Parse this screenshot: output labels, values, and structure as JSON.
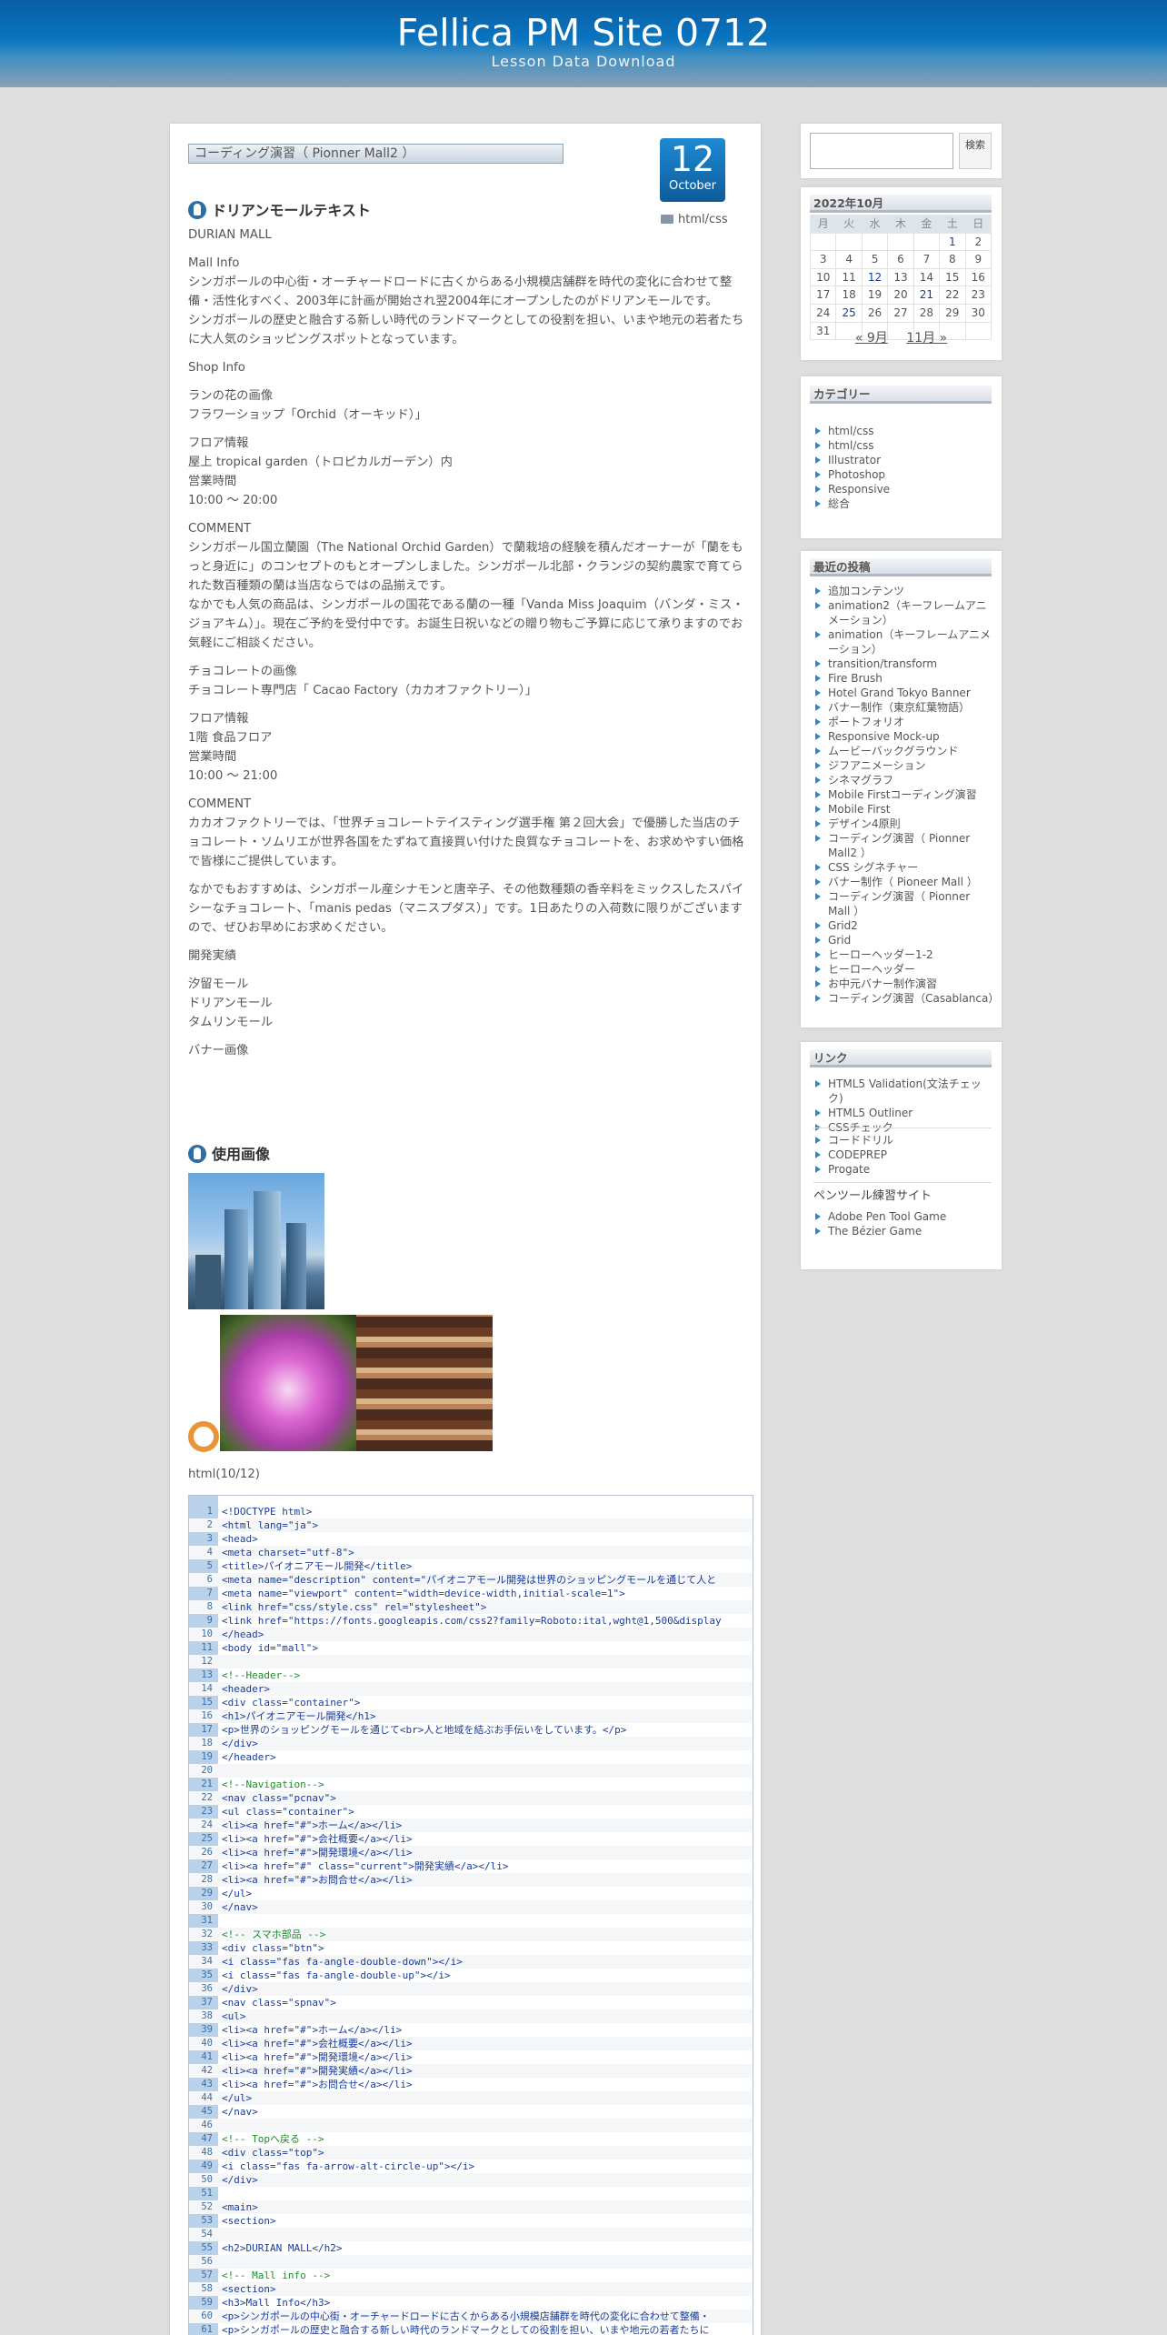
{
  "header": {
    "title": "Fellica PM Site 0712",
    "description": "Lesson Data Download"
  },
  "post": {
    "title": "コーディング演習（ Pionner Mall2 ）",
    "date_day": "12",
    "date_month": "October",
    "category": "html/css",
    "section_text_heading": "ドリアンモールテキスト",
    "paragraphs": [
      "DURIAN MALL",
      "Mall Info\nシンガポールの中心街・オーチャードロードに古くからある小規模店舗群を時代の変化に合わせて整備・活性化すべく、2003年に計画が開始され翌2004年にオープンしたのがドリアンモールです。\nシンガポールの歴史と融合する新しい時代のランドマークとしての役割を担い、いまや地元の若者たちに大人気のショッピングスポットとなっています。",
      "Shop Info",
      "ランの花の画像\nフラワーショップ「Orchid（オーキッド）」",
      "フロア情報\n屋上 tropical garden（トロピカルガーデン）内\n営業時間\n10:00 ～ 20:00",
      "COMMENT\nシンガポール国立蘭園（The National Orchid Garden）で蘭栽培の経験を積んだオーナーが「蘭をもっと身近に」のコンセプトのもとオープンしました。シンガポール北部・クランジの契約農家で育てられた数百種類の蘭は当店ならではの品揃えです。\nなかでも人気の商品は、シンガポールの国花である蘭の一種「Vanda Miss Joaquim（バンダ・ミス・ジョアキム）」。現在ご予約を受付中です。お誕生日祝いなどの贈り物もご予算に応じて承りますのでお気軽にご相談ください。",
      "チョコレートの画像\nチョコレート専門店「 Cacao Factory（カカオファクトリー）」",
      "フロア情報\n1階 食品フロア\n営業時間\n10:00 ～ 21:00",
      "COMMENT\nカカオファクトリーでは、「世界チョコレートテイスティング選手権 第２回大会」で優勝した当店のチョコレート・ソムリエが世界各国をたずねて直接買い付けた良質なチョコレートを、お求めやすい価格で皆様にご提供しています。",
      "なかでもおすすめは、シンガポール産シナモンと唐辛子、その他数種類の香辛料をミックスしたスパイシーなチョコレート、「manis pedas（マニスプダス）」です。1日あたりの入荷数に限りがございますので、ぜひお早めにお求めください。",
      "開発実績",
      "汐留モール\nドリアンモール\nタムリンモール",
      "バナー画像"
    ],
    "section_images_heading": "使用画像",
    "code_label": "html(10/12)",
    "code_lines": [
      "<!DOCTYPE html>",
      "<html lang=\"ja\">",
      "<head>",
      "<meta charset=\"utf-8\">",
      "<title>パイオニアモール開発</title>",
      "<meta name=\"description\" content=\"パイオニアモール開発は世界のショッピングモールを通じて人と",
      "<meta name=\"viewport\" content=\"width=device-width,initial-scale=1\">",
      "<link href=\"css/style.css\" rel=\"stylesheet\">",
      "<link href=\"https://fonts.googleapis.com/css2?family=Roboto:ital,wght@1,500&display",
      "</head>",
      "<body id=\"mall\">",
      "",
      "<!--Header-->",
      "<header>",
      "<div class=\"container\">",
      "<h1>パイオニアモール開発</h1>",
      "<p>世界のショッピングモールを通じて<br>人と地域を結ぶお手伝いをしています。</p>",
      "</div>",
      "</header>",
      "",
      "<!--Navigation-->",
      "<nav class=\"pcnav\">",
      "<ul class=\"container\">",
      "<li><a href=\"#\">ホーム</a></li>",
      "<li><a href=\"#\">会社概要</a></li>",
      "<li><a href=\"#\">開発環境</a></li>",
      "<li><a href=\"#\" class=\"current\">開発実績</a></li>",
      "<li><a href=\"#\">お問合せ</a></li>",
      "</ul>",
      "</nav>",
      "",
      "<!-- スマホ部品 -->",
      "<div class=\"btn\">",
      "<i class=\"fas fa-angle-double-down\"></i>",
      "<i class=\"fas fa-angle-double-up\"></i>",
      "</div>",
      "<nav class=\"spnav\">",
      "<ul>",
      "<li><a href=\"#\">ホーム</a></li>",
      "<li><a href=\"#\">会社概要</a></li>",
      "<li><a href=\"#\">開発環境</a></li>",
      "<li><a href=\"#\">開発実績</a></li>",
      "<li><a href=\"#\">お問合せ</a></li>",
      "</ul>",
      "</nav>",
      "",
      "<!-- Topへ戻る -->",
      "<div class=\"top\">",
      "<i class=\"fas fa-arrow-alt-circle-up\"></i>",
      "</div>",
      "",
      "<main>",
      "<section>",
      "",
      "<h2>DURIAN MALL</h2>",
      "",
      "<!-- Mall info -->",
      "<section>",
      "<h3>Mall Info</h3>",
      "<p>シンガポールの中心街・オーチャードロードに古くからある小規模店舗群を時代の変化に合わせて整備・",
      "<p>シンガポールの歴史と融合する新しい時代のランドマークとしての役割を担い、いまや地元の若者たちに"
    ]
  },
  "sidebar": {
    "search_button": "検索",
    "calendar": {
      "title": "2022年10月",
      "weekdays": [
        "月",
        "火",
        "水",
        "木",
        "金",
        "土",
        "日"
      ],
      "rows": [
        [
          "",
          "",
          "",
          "",
          "",
          "1",
          "2"
        ],
        [
          "3",
          "4",
          "5",
          "6",
          "7",
          "8",
          "9"
        ],
        [
          "10",
          "11",
          "12",
          "13",
          "14",
          "15",
          "16"
        ],
        [
          "17",
          "18",
          "19",
          "20",
          "21",
          "22",
          "23"
        ],
        [
          "24",
          "25",
          "26",
          "27",
          "28",
          "29",
          "30"
        ],
        [
          "31",
          "",
          "",
          "",
          "",
          "",
          ""
        ]
      ],
      "linked_days": [
        "1",
        "12",
        "21",
        "25"
      ],
      "prev": "« 9月",
      "next": "11月 »"
    },
    "categories": {
      "title": "カテゴリー",
      "items": [
        "html/css",
        "html/css",
        "Illustrator",
        "Photoshop",
        "Responsive",
        "総合"
      ]
    },
    "recent": {
      "title": "最近の投稿",
      "items": [
        "追加コンテンツ",
        "animation2（キーフレームアニメーション）",
        "animation（キーフレームアニメーション）",
        "transition/transform",
        "Fire Brush",
        "Hotel Grand Tokyo Banner",
        "バナー制作（東京紅葉物語）",
        "ポートフォリオ",
        "Responsive Mock-up",
        "ムービーバックグラウンド",
        "ジフアニメーション",
        "シネマグラフ",
        "Mobile Firstコーディング演習",
        "Mobile First",
        "デザイン4原則",
        "コーディング演習（ Pionner Mall2 ）",
        "CSS シグネチャー",
        "バナー制作（ Pioneer Mall ）",
        "コーディング演習（ Pionner Mall ）",
        "Grid2",
        "Grid",
        "ヒーローヘッダー1-2",
        "ヒーローヘッダー",
        "お中元バナー制作演習",
        "コーディング演習（Casablanca）"
      ]
    },
    "links": {
      "title": "リンク",
      "group1": [
        "HTML5 Validation(文法チェック)",
        "HTML5 Outliner",
        "CSSチェック"
      ],
      "group2": [
        "コードドリル",
        "CODEPREP",
        "Progate"
      ],
      "subheading": "ペンツール練習サイト",
      "group3": [
        "Adobe Pen Tool Game",
        "The Bézier Game"
      ]
    }
  }
}
